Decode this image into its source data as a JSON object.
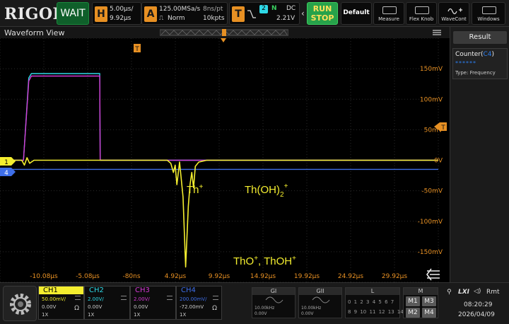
{
  "header": {
    "logo": "RIGOL",
    "acq_state": "WAIT",
    "horizontal": {
      "letter": "H",
      "scale": "5.00μs/",
      "offset": "9.92μs"
    },
    "acquire": {
      "letter": "A",
      "sample_rate": "125.00MSa/s",
      "mode": "Norm",
      "pts": "8ns/pt",
      "depth": "10kpts"
    },
    "trigger": {
      "letter": "T",
      "source": "2",
      "status": "N",
      "coupling": "DC",
      "level": "2.21V"
    },
    "run_stop": [
      "RUN",
      "STOP"
    ],
    "default_label": "Default",
    "tools": [
      "Measure",
      "Flex Knob",
      "WaveCont",
      "Windows"
    ]
  },
  "waveform_view": {
    "title": "Waveform View"
  },
  "result_panel": {
    "title": "Result",
    "counter_label": "Counter(",
    "counter_source": "C4",
    "counter_close": ")",
    "counter_value": "******",
    "counter_type": "Type:  Frequency"
  },
  "annotations": {
    "th": "Th",
    "th_sup": "+",
    "thoh2": "Th(OH)",
    "thoh2_sub": "2",
    "thoh2_sup": "+",
    "tho": "ThO",
    "tho_sup": "+",
    "tho_sep": ", ThOH",
    "thoh_sup": "+"
  },
  "markers": {
    "ch1": "1",
    "ch4": "4",
    "trigger_pos": "T",
    "trigger_level": "T"
  },
  "channels": [
    {
      "name": "CH1",
      "scale": "50.00mV/",
      "offset": "0.00V",
      "probe": "1X",
      "impedance": "Ω",
      "color": "#f4ee2f"
    },
    {
      "name": "CH2",
      "scale": "2.00V/",
      "offset": "0.00V",
      "probe": "1X",
      "color": "#2ed8e6"
    },
    {
      "name": "CH3",
      "scale": "2.00V/",
      "offset": "0.00V",
      "probe": "1X",
      "color": "#d63ad6"
    },
    {
      "name": "CH4",
      "scale": "200.00mV/",
      "offset": "-72.00mV",
      "probe": "1X",
      "impedance": "Ω",
      "color": "#3e6ee8"
    }
  ],
  "generators": [
    {
      "name": "GI",
      "freq": "10.00kHz",
      "amp": "0.00V"
    },
    {
      "name": "GII",
      "freq": "10.00kHz",
      "amp": "0.00V"
    }
  ],
  "logic": {
    "name": "L",
    "row1": "0  1  2  3   4  5  6  7",
    "row2": "8  9  10  11  12 13 14 15"
  },
  "math": {
    "name": "M",
    "buttons": [
      "M1",
      "M3",
      "M2",
      "M4"
    ]
  },
  "status": {
    "lxi": "LXI",
    "rmt": "Rmt",
    "time": "08:20:29",
    "date": "2026/04/09"
  },
  "colors": {
    "ch1": "#f4ee2f",
    "ch2": "#2ed8e6",
    "ch3": "#d63ad6",
    "ch4": "#3e6ee8",
    "trigger": "#e79023"
  },
  "chart_data": {
    "type": "line",
    "x_unit": "μs",
    "y_unit": "mV",
    "x_ticks": [
      "-10.08μs",
      "-5.08μs",
      "-80ns",
      "4.92μs",
      "9.92μs",
      "14.92μs",
      "19.92μs",
      "24.92μs",
      "29.92μs"
    ],
    "x_tick_values": [
      -10.08,
      -5.08,
      -0.08,
      4.92,
      9.92,
      14.92,
      19.92,
      24.92,
      29.92
    ],
    "y_ticks": [
      "150mV",
      "100mV",
      "50mV",
      "0V",
      "-50mV",
      "-100mV",
      "-150mV"
    ],
    "y_tick_values": [
      150,
      100,
      50,
      0,
      -50,
      -100,
      -150
    ],
    "xlim": [
      -15.08,
      34.92
    ],
    "ylim": [
      -200,
      200
    ],
    "grid": true,
    "series": [
      {
        "name": "CH1",
        "color": "#f4ee2f",
        "x": [
          -15.08,
          -12.6,
          -12.3,
          -12.0,
          -11.7,
          -11.2,
          4.0,
          4.4,
          4.7,
          4.9,
          5.1,
          5.4,
          5.8,
          6.1,
          6.4,
          6.6,
          6.8,
          7.0,
          7.2,
          7.6,
          8.5,
          34.92
        ],
        "y": [
          0,
          0,
          -8,
          4,
          -5,
          0,
          0,
          -5,
          -20,
          -8,
          -40,
          -3,
          -60,
          -175,
          -75,
          -40,
          -20,
          -45,
          -10,
          -3,
          0,
          0
        ]
      },
      {
        "name": "CH2",
        "color": "#2ed8e6",
        "x": [
          -15.08,
          -12.4,
          -11.8,
          -11.5,
          -3.7,
          -3.65,
          34.92
        ],
        "y": [
          0,
          0,
          135,
          142,
          142,
          0,
          0
        ]
      },
      {
        "name": "CH3",
        "color": "#d63ad6",
        "x": [
          -15.08,
          -12.4,
          -11.8,
          -11.5,
          -3.7,
          -3.65,
          34.92
        ],
        "y": [
          0,
          0,
          130,
          138,
          138,
          0,
          0
        ]
      },
      {
        "name": "CH4",
        "color": "#3e6ee8",
        "x": [
          -15.08,
          34.92
        ],
        "y": [
          -15,
          -15
        ]
      }
    ]
  }
}
